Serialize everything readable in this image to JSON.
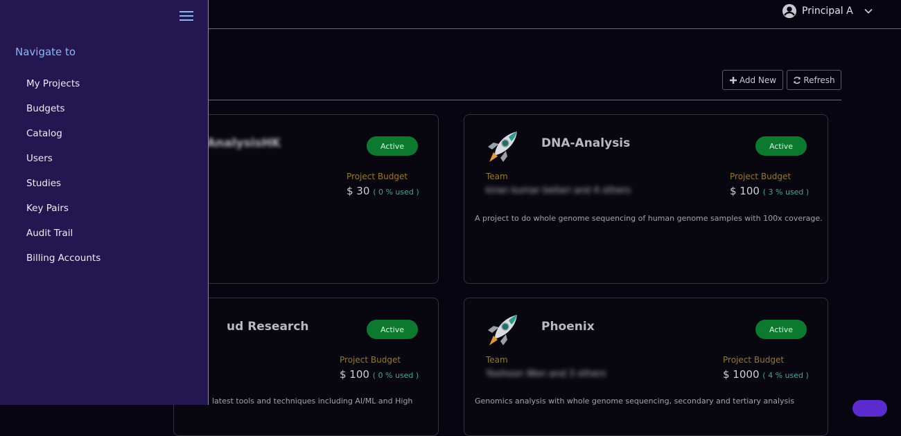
{
  "header": {
    "user_name": "Principal A",
    "user_icon": "account-circle-icon",
    "dropdown_icon": "chevron-down-icon"
  },
  "toolbar": {
    "add_new_label": "Add New",
    "refresh_label": "Refresh"
  },
  "sidebar": {
    "menu_icon": "hamburger-menu-icon",
    "heading": "Navigate to",
    "items": [
      {
        "label": "My Projects"
      },
      {
        "label": "Budgets"
      },
      {
        "label": "Catalog"
      },
      {
        "label": "Users"
      },
      {
        "label": "Studies"
      },
      {
        "label": "Key Pairs"
      },
      {
        "label": "Audit Trail"
      },
      {
        "label": "Billing Accounts"
      }
    ]
  },
  "projects": [
    {
      "title": "AnalysisHK",
      "status": "Active",
      "budget_label": "Project Budget",
      "budget_amount": "$ 30",
      "budget_used": "( 0 % used )"
    },
    {
      "title": "DNA-Analysis",
      "status": "Active",
      "team_label": "Team",
      "team_value": "kiran kumar bellari and 4 others",
      "budget_label": "Project Budget",
      "budget_amount": "$ 100",
      "budget_used": "( 3 % used )",
      "description": "A project to do whole genome sequencing of human genome samples with 100x coverage."
    },
    {
      "title": "ud Research",
      "status": "Active",
      "budget_label": "Project Budget",
      "budget_amount": "$ 100",
      "budget_used": "( 0 % used )",
      "description": "latest tools and techniques including AI/ML and High"
    },
    {
      "title": "Phoenix",
      "status": "Active",
      "team_label": "Team",
      "team_value": "Yoohoon Won and 3 others",
      "budget_label": "Project Budget",
      "budget_amount": "$ 1000",
      "budget_used": "( 4 % used )",
      "description": "Genomics analysis with whole genome sequencing, secondary and tertiary analysis"
    }
  ],
  "colors": {
    "sidebar_bg": "#231651",
    "active_badge": "#0c7a2e",
    "budget_label": "#9a7a1e",
    "usage_pct": "#3fa99a"
  }
}
